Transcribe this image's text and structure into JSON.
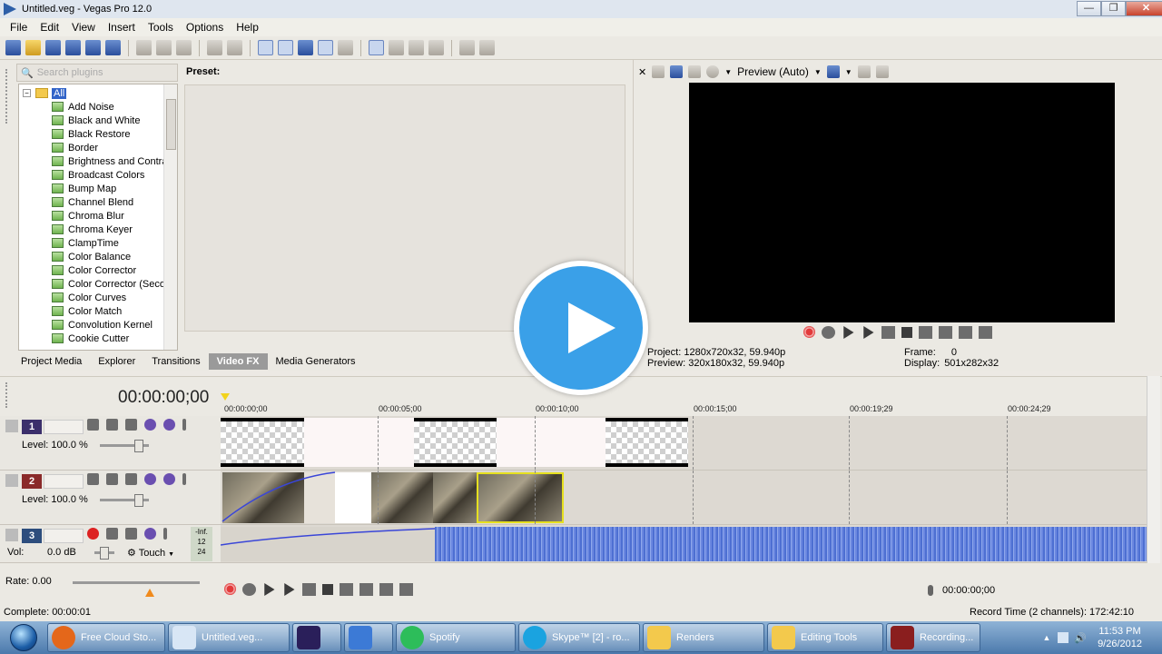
{
  "window": {
    "title": "Untitled.veg - Vegas Pro 12.0",
    "minimize": "—",
    "maximize": "❐",
    "close": "✕"
  },
  "menu": [
    "File",
    "Edit",
    "View",
    "Insert",
    "Tools",
    "Options",
    "Help"
  ],
  "plugins": {
    "search_placeholder": "Search plugins",
    "root": "All",
    "items": [
      "Add Noise",
      "Black and White",
      "Black Restore",
      "Border",
      "Brightness and Contrast",
      "Broadcast Colors",
      "Bump Map",
      "Channel Blend",
      "Chroma Blur",
      "Chroma Keyer",
      "ClampTime",
      "Color Balance",
      "Color Corrector",
      "Color Corrector (Secondary)",
      "Color Curves",
      "Color Match",
      "Convolution Kernel",
      "Cookie Cutter"
    ],
    "preset_label": "Preset:"
  },
  "tabs": [
    {
      "label": "Project Media",
      "active": false
    },
    {
      "label": "Explorer",
      "active": false
    },
    {
      "label": "Transitions",
      "active": false
    },
    {
      "label": "Video FX",
      "active": true
    },
    {
      "label": "Media Generators",
      "active": false
    }
  ],
  "preview": {
    "mode": "Preview (Auto)",
    "project_label": "Project:",
    "project_value": "1280x720x32, 59.940p",
    "preview_label": "Preview:",
    "preview_value": "320x180x32, 59.940p",
    "frame_label": "Frame:",
    "frame_value": "0",
    "display_label": "Display:",
    "display_value": "501x282x32"
  },
  "timeline": {
    "timecode": "00:00:00;00",
    "ruler": [
      "00:00:00;00",
      "00:00:05;00",
      "00:00:10;00",
      "00:00:15;00",
      "00:00:19;29",
      "00:00:24;29"
    ],
    "tracks": [
      {
        "number": "1",
        "type": "video",
        "level_label": "Level: 100.0 %",
        "color": "#3b2f6b"
      },
      {
        "number": "2",
        "type": "video",
        "level_label": "Level: 100.0 %",
        "color": "#8a2a2a"
      },
      {
        "number": "3",
        "type": "audio",
        "vol_label": "Vol:",
        "vol_value": "0.0 dB",
        "mode": "Touch",
        "color": "#2d4d7d"
      }
    ],
    "meter_labels": [
      "-Inf.",
      "12",
      "24"
    ]
  },
  "bottom": {
    "rate": "Rate: 0.00",
    "timecode": "00:00:00;00",
    "complete": "Complete: 00:00:01",
    "record_time": "Record Time (2 channels): 172:42:10"
  },
  "taskbar": {
    "items": [
      {
        "label": "",
        "color": "#e4671a"
      },
      {
        "label": "Free Cloud Sto...",
        "color": "#e4671a"
      },
      {
        "label": "Untitled.veg...",
        "color": "#d8e6f5"
      },
      {
        "label": "",
        "color": "#2a1f5a"
      },
      {
        "label": "",
        "color": "#3c7ad6"
      },
      {
        "label": "Spotify",
        "color": "#2dbd5a"
      },
      {
        "label": "Skype™ [2] - ro...",
        "color": "#1aa3e0"
      },
      {
        "label": "Renders",
        "color": "#f3c94c"
      },
      {
        "label": "Editing Tools",
        "color": "#f3c94c"
      },
      {
        "label": "Recording...",
        "color": "#8a1e1e"
      }
    ],
    "time": "11:53 PM",
    "date": "9/26/2012"
  },
  "colors": {
    "accent": "#3264c8",
    "play_overlay": "#3aa0e8"
  }
}
